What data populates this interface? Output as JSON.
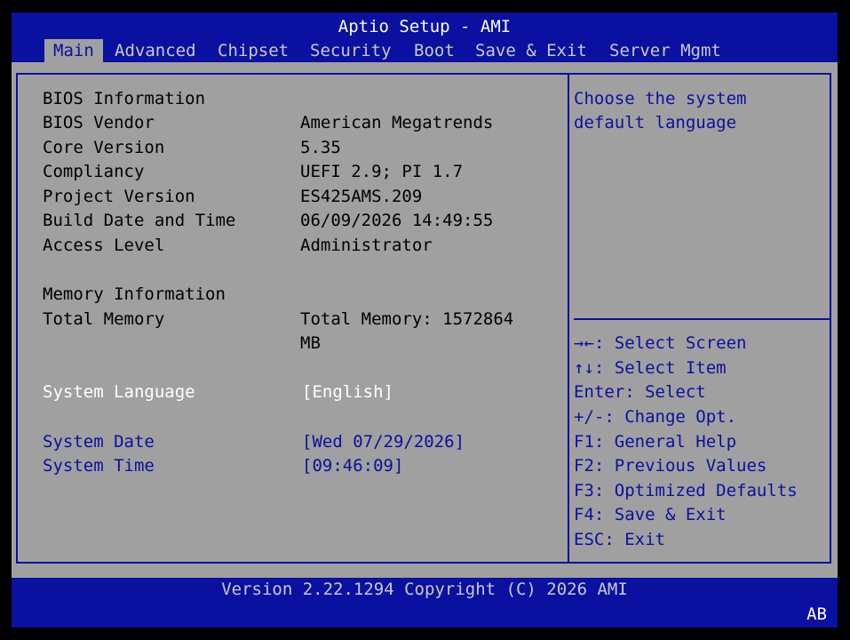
{
  "header": {
    "title": "Aptio Setup - AMI",
    "tabs": [
      {
        "label": "Main",
        "active": true
      },
      {
        "label": "Advanced"
      },
      {
        "label": "Chipset"
      },
      {
        "label": "Security"
      },
      {
        "label": "Boot"
      },
      {
        "label": "Save & Exit"
      },
      {
        "label": "Server Mgmt"
      }
    ]
  },
  "main": {
    "bios_info_heading": "BIOS Information",
    "bios_vendor_label": "BIOS Vendor",
    "bios_vendor_value": "American Megatrends",
    "core_version_label": "Core Version",
    "core_version_value": "5.35",
    "compliancy_label": "Compliancy",
    "compliancy_value": "UEFI 2.9; PI 1.7",
    "project_version_label": "Project Version",
    "project_version_value": "ES425AMS.209",
    "build_date_label": "Build Date and Time",
    "build_date_value": "06/09/2026 14:49:55",
    "access_level_label": "Access Level",
    "access_level_value": "Administrator",
    "memory_info_heading": "Memory Information",
    "total_memory_label": "Total Memory",
    "total_memory_value_line1": "Total Memory: 1572864",
    "total_memory_value_line2": "MB",
    "system_language_label": "System Language",
    "system_language_value": "[English]",
    "system_date_label": "System Date",
    "system_date_value": "[Wed 07/29/2026]",
    "system_time_label": "System Time",
    "system_time_value": "[09:46:09]"
  },
  "help": {
    "description_line1": "Choose the system",
    "description_line2": "default language",
    "keys": [
      "→←: Select Screen",
      "↑↓: Select Item",
      "Enter: Select",
      "+/-: Change Opt.",
      "F1: General Help",
      "F2: Previous Values",
      "F3: Optimized Defaults",
      "F4: Save & Exit",
      "ESC: Exit"
    ]
  },
  "footer": {
    "version": "Version 2.22.1294 Copyright (C) 2026 AMI",
    "corner": "AB"
  },
  "colors": {
    "bios_blue": "#0a10a0",
    "panel_gray": "#a0a0a0",
    "selected_white": "#ffffff"
  }
}
